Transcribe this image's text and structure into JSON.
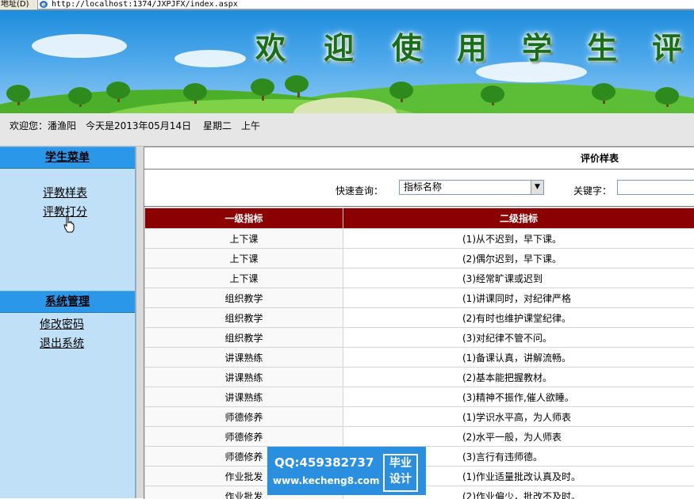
{
  "address_bar": {
    "label": "地址(D)",
    "url": "http://localhost:1374/JXPJFX/index.aspx"
  },
  "banner": {
    "title_chars": [
      "欢",
      "迎",
      "使",
      "用",
      "学",
      "生",
      "评"
    ]
  },
  "welcome": {
    "user": "欢迎您：潘渔阳",
    "date": "今天是2013年05月14日",
    "weekday": "星期二",
    "period": "上午"
  },
  "sidebar": {
    "student_menu": "学生菜单",
    "student_items": [
      {
        "label": "评教样表"
      },
      {
        "label": "评教打分"
      }
    ],
    "system_menu": "系统管理",
    "system_items": [
      {
        "label": "修改密码"
      },
      {
        "label": "退出系统"
      }
    ]
  },
  "main": {
    "title": "评价样表",
    "quick_query_label": "快速查询：",
    "quick_query_value": "指标名称",
    "keyword_label": "关键字：",
    "keyword_value": "",
    "table": {
      "headers": [
        "一级指标",
        "二级指标"
      ],
      "rows": [
        [
          "上下课",
          "(1)从不迟到，早下课。"
        ],
        [
          "上下课",
          "(2)偶尔迟到，早下课。"
        ],
        [
          "上下课",
          "(3)经常旷课或迟到"
        ],
        [
          "组织教学",
          "(1)讲课同时，对纪律严格"
        ],
        [
          "组织教学",
          "(2)有时也维护课堂纪律。"
        ],
        [
          "组织教学",
          "(3)对纪律不管不问。"
        ],
        [
          "讲课熟练",
          "(1)备课认真，讲解流畅。"
        ],
        [
          "讲课熟练",
          "(2)基本能把握教材。"
        ],
        [
          "讲课熟练",
          "(3)精神不振作,催人欲睡。"
        ],
        [
          "师德修养",
          "(1)学识水平高，为人师表"
        ],
        [
          "师德修养",
          "(2)水平一般，为人师表"
        ],
        [
          "师德修养",
          "(3)言行有违师德。"
        ],
        [
          "作业批发",
          "(1)作业适量批改认真及时。"
        ],
        [
          "作业批发",
          "(2)作业偏少，批改不及时。"
        ]
      ]
    }
  },
  "watermark": {
    "qq": "QQ:459382737",
    "site": "www.kecheng8.com",
    "badge_line1": "毕业",
    "badge_line2": "设计"
  }
}
